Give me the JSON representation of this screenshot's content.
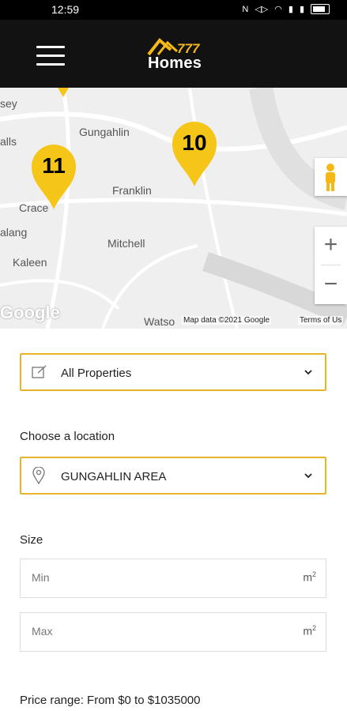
{
  "status_bar": {
    "time": "12:59"
  },
  "header": {
    "logo_number": "777",
    "logo_text": "Homes"
  },
  "map": {
    "labels": [
      "sey",
      "Gungahlin",
      "alls",
      "Franklin",
      "Crace",
      "alang",
      "Mitchell",
      "Kaleen",
      "Watso"
    ],
    "markers": [
      {
        "count": "11"
      },
      {
        "count": "10"
      }
    ],
    "zoom_in": "+",
    "zoom_out": "−",
    "google": "Google",
    "map_data": "Map data ©2021 Google",
    "terms": "Terms of Us"
  },
  "form": {
    "property_type": "All Properties",
    "location_label": "Choose a location",
    "location_value": "GUNGAHLIN AREA",
    "size_label": "Size",
    "min_placeholder": "Min",
    "max_placeholder": "Max",
    "unit": "m",
    "unit_sup": "2",
    "price_range": "Price range: From $0 to $1035000"
  },
  "colors": {
    "accent": "#f5c518",
    "border": "#e8b52a",
    "header": "#121212"
  }
}
